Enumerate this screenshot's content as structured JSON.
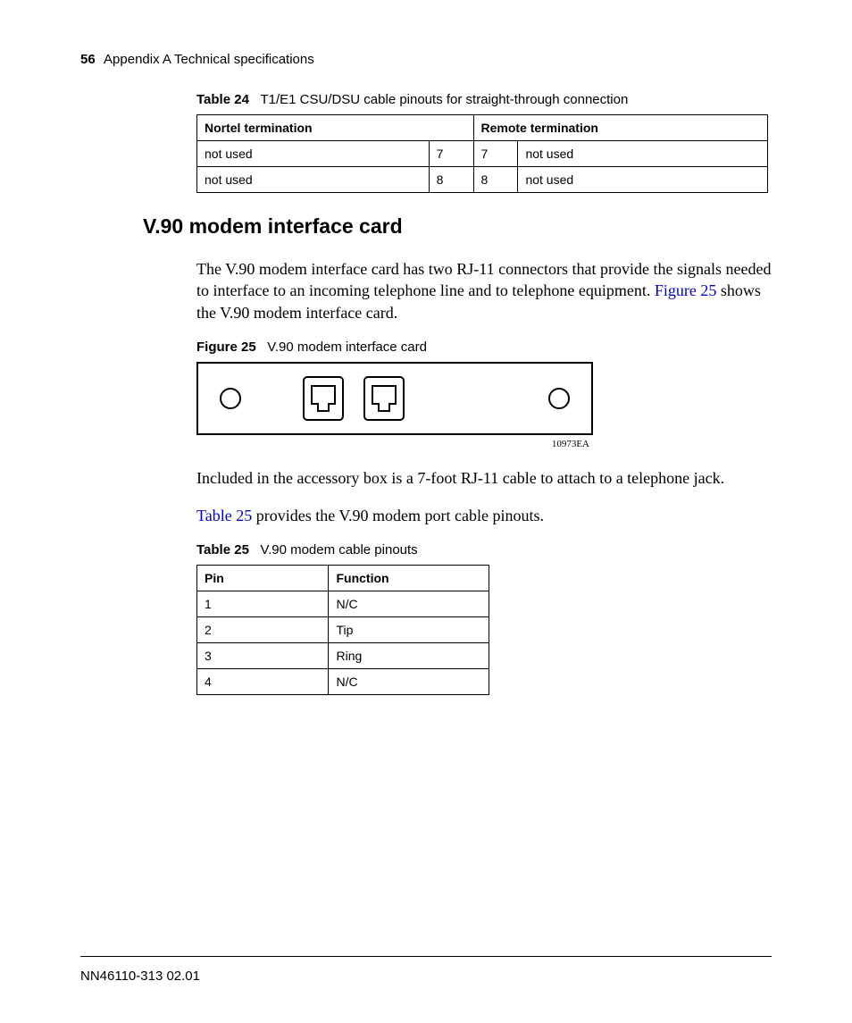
{
  "header": {
    "page_number": "56",
    "title": "Appendix A  Technical specifications"
  },
  "table24": {
    "label": "Table 24",
    "caption": "T1/E1 CSU/DSU cable pinouts for straight-through connection",
    "head": {
      "left": "Nortel termination",
      "right": "Remote termination"
    },
    "rows": [
      {
        "a": "not used",
        "b": "7",
        "c": "7",
        "d": "not used"
      },
      {
        "a": "not used",
        "b": "8",
        "c": "8",
        "d": "not used"
      }
    ]
  },
  "section_heading": "V.90 modem interface card",
  "para1_a": "The V.90 modem interface card has two RJ-11 connectors that provide the signals needed to interface to an incoming telephone line and to telephone equipment. ",
  "para1_link": "Figure 25",
  "para1_b": " shows the V.90 modem interface card.",
  "figure25": {
    "label": "Figure 25",
    "caption": "V.90 modem interface card",
    "id": "10973EA"
  },
  "para2": "Included in the accessory box is a 7-foot RJ-11 cable to attach to a telephone jack.",
  "para3_link": "Table 25",
  "para3_b": " provides the V.90 modem port cable pinouts.",
  "table25": {
    "label": "Table 25",
    "caption": "V.90 modem cable pinouts",
    "head": {
      "pin": "Pin",
      "func": "Function"
    },
    "rows": [
      {
        "pin": "1",
        "func": "N/C"
      },
      {
        "pin": "2",
        "func": "Tip"
      },
      {
        "pin": "3",
        "func": "Ring"
      },
      {
        "pin": "4",
        "func": "N/C"
      }
    ]
  },
  "footer": "NN46110-313 02.01"
}
